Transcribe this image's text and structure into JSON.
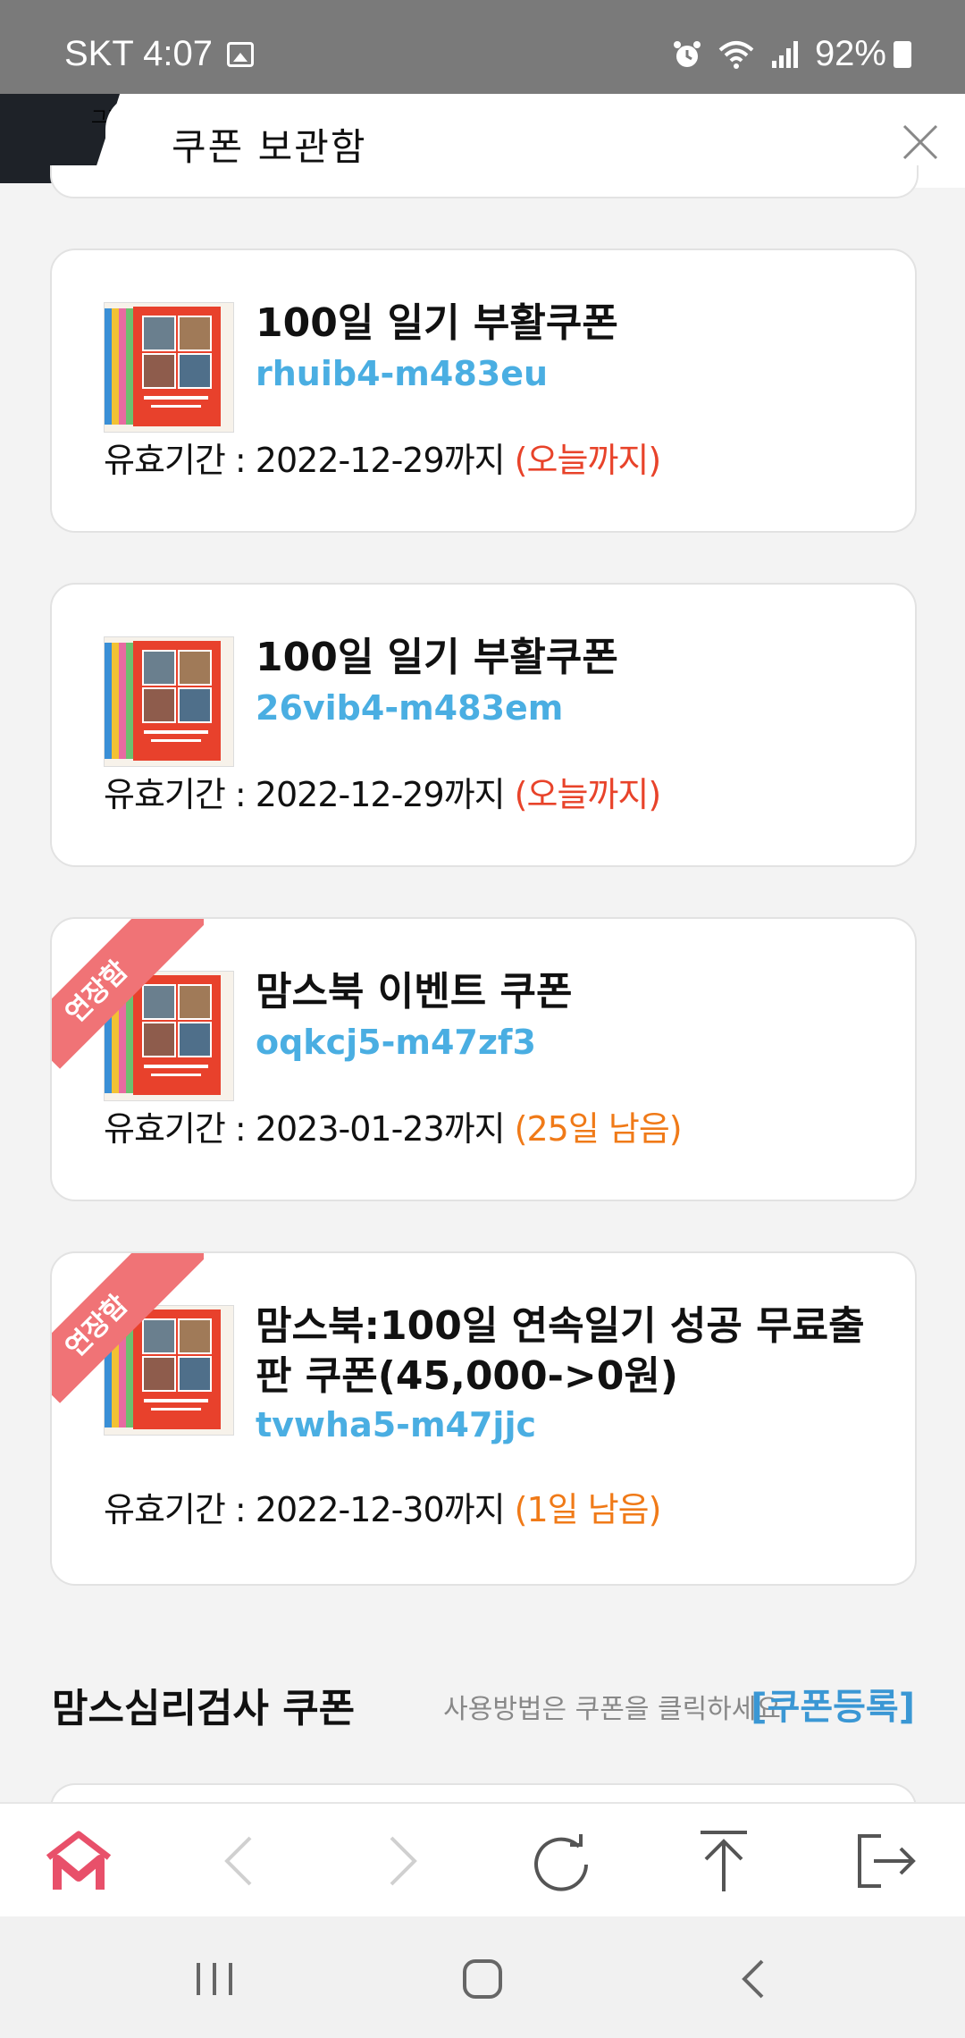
{
  "status_bar": {
    "carrier_time": "SKT 4:07",
    "battery": "92%"
  },
  "header": {
    "title": "쿠폰 보관함",
    "partial_text": "그랜"
  },
  "coupons": [
    {
      "name": "100일 일기 부활쿠폰",
      "code": "rhuib4-m483eu",
      "validity_label": "유효기간 : 2022-12-29까지",
      "remaining": "(오늘까지)",
      "remaining_color": "#e8432a",
      "extended": false
    },
    {
      "name": "100일 일기 부활쿠폰",
      "code": "26vib4-m483em",
      "validity_label": "유효기간 : 2022-12-29까지",
      "remaining": "(오늘까지)",
      "remaining_color": "#e8432a",
      "extended": false
    },
    {
      "name": "맘스북 이벤트 쿠폰",
      "code": "oqkcj5-m47zf3",
      "validity_label": "유효기간 : 2023-01-23까지",
      "remaining": "(25일 남음)",
      "remaining_color": "#f07a18",
      "extended": true,
      "ribbon": "연장함"
    },
    {
      "name": "맘스북:100일 연속일기 성공 무료출판 쿠폰(45,000->0원)",
      "code": "tvwha5-m47jjc",
      "validity_label": "유효기간 : 2022-12-30까지",
      "remaining": "(1일 남음)",
      "remaining_color": "#f07a18",
      "extended": true,
      "ribbon": "연장함"
    }
  ],
  "section": {
    "title": "맘스심리검사 쿠폰",
    "hint": "사용방법은 쿠폰을 클릭하세요",
    "register": "[쿠폰등록]"
  },
  "toolbar": {
    "icons": [
      "home-m-icon",
      "back-icon",
      "forward-icon",
      "refresh-icon",
      "scroll-top-icon",
      "logout-icon"
    ],
    "brand_color": "#e8506a"
  },
  "nav": {
    "icons": [
      "recent-apps-icon",
      "home-icon",
      "back-icon"
    ]
  }
}
